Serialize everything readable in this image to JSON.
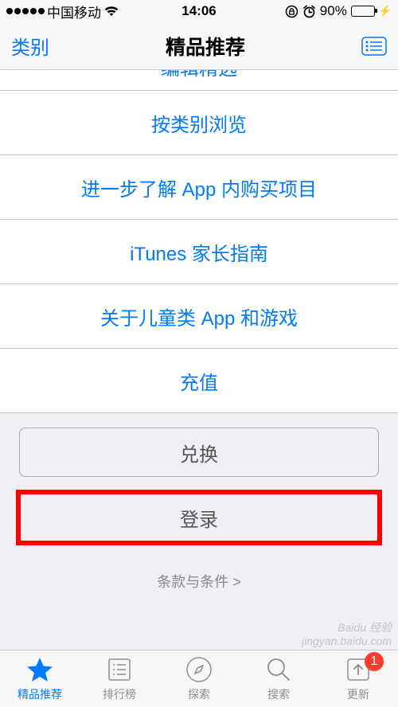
{
  "status": {
    "carrier": "中国移动",
    "time": "14:06",
    "battery_pct": "90%"
  },
  "nav": {
    "left": "类别",
    "title": "精品推荐"
  },
  "list": {
    "cutoff": "编辑精选",
    "items": [
      "按类别浏览",
      "进一步了解 App 内购买项目",
      "iTunes 家长指南",
      "关于儿童类 App 和游戏",
      "充值"
    ]
  },
  "buttons": {
    "redeem": "兑换",
    "login": "登录"
  },
  "terms": "条款与条件 >",
  "tabs": {
    "featured": "精品推荐",
    "charts": "排行榜",
    "explore": "探索",
    "search": "搜索",
    "updates": "更新",
    "badge": "1"
  },
  "watermark": {
    "line1": "Baidu 经验",
    "line2": "jingyan.baidu.com"
  }
}
